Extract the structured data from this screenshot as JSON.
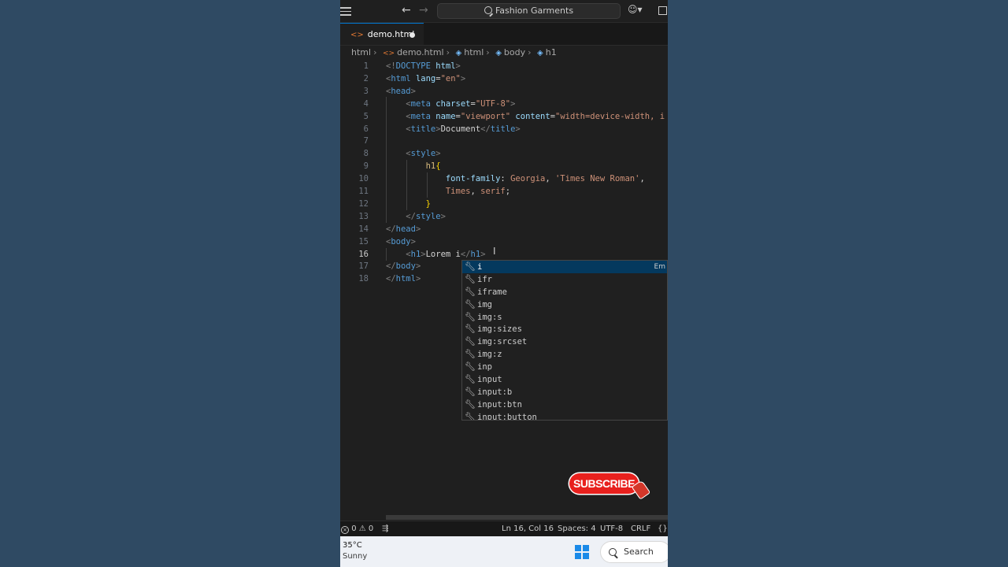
{
  "titlebar": {
    "search_text": "Fashion Garments",
    "icons": [
      "menu-icon",
      "arrow-left-icon",
      "arrow-right-icon",
      "copilot-icon",
      "layout-icon"
    ]
  },
  "tabs": [
    {
      "label": "demo.html",
      "modified": true
    }
  ],
  "breadcrumb": [
    "html",
    "demo.html",
    "html",
    "body",
    "h1"
  ],
  "editor": {
    "lines": [
      {
        "n": "1",
        "segments": [
          [
            "tg",
            "<!"
          ],
          [
            "tn",
            "DOCTYPE"
          ],
          [
            "tx",
            " "
          ],
          [
            "at",
            "html"
          ],
          [
            "tg",
            ">"
          ]
        ]
      },
      {
        "n": "2",
        "segments": [
          [
            "tg",
            "<"
          ],
          [
            "tn",
            "html"
          ],
          [
            "tx",
            " "
          ],
          [
            "at",
            "lang"
          ],
          [
            "tx",
            "="
          ],
          [
            "sv",
            "\"en\""
          ],
          [
            "tg",
            ">"
          ]
        ]
      },
      {
        "n": "3",
        "segments": [
          [
            "tg",
            "<"
          ],
          [
            "tn",
            "head"
          ],
          [
            "tg",
            ">"
          ]
        ]
      },
      {
        "n": "4",
        "segments": [
          [
            "tx",
            "    "
          ],
          [
            "tg",
            "<"
          ],
          [
            "tn",
            "meta"
          ],
          [
            "tx",
            " "
          ],
          [
            "at",
            "charset"
          ],
          [
            "tx",
            "="
          ],
          [
            "sv",
            "\"UTF-8\""
          ],
          [
            "tg",
            ">"
          ]
        ]
      },
      {
        "n": "5",
        "segments": [
          [
            "tx",
            "    "
          ],
          [
            "tg",
            "<"
          ],
          [
            "tn",
            "meta"
          ],
          [
            "tx",
            " "
          ],
          [
            "at",
            "name"
          ],
          [
            "tx",
            "="
          ],
          [
            "sv",
            "\"viewport\""
          ],
          [
            "tx",
            " "
          ],
          [
            "at",
            "content"
          ],
          [
            "tx",
            "="
          ],
          [
            "sv",
            "\"width=device-width, i"
          ]
        ]
      },
      {
        "n": "6",
        "segments": [
          [
            "tx",
            "    "
          ],
          [
            "tg",
            "<"
          ],
          [
            "tn",
            "title"
          ],
          [
            "tg",
            ">"
          ],
          [
            "tx",
            "Document"
          ],
          [
            "tg",
            "</"
          ],
          [
            "tn",
            "title"
          ],
          [
            "tg",
            ">"
          ]
        ]
      },
      {
        "n": "7",
        "segments": []
      },
      {
        "n": "8",
        "segments": [
          [
            "tx",
            "    "
          ],
          [
            "tg",
            "<"
          ],
          [
            "tn",
            "style"
          ],
          [
            "tg",
            ">"
          ]
        ]
      },
      {
        "n": "9",
        "segments": [
          [
            "tx",
            "        "
          ],
          [
            "sel",
            "h1"
          ],
          [
            "br",
            "{"
          ]
        ]
      },
      {
        "n": "10",
        "segments": [
          [
            "tx",
            "            "
          ],
          [
            "pr",
            "font-family"
          ],
          [
            "tx",
            ": "
          ],
          [
            "vl",
            "Georgia"
          ],
          [
            "tx",
            ", "
          ],
          [
            "vl",
            "'Times New Roman'"
          ],
          [
            "tx",
            ","
          ]
        ]
      },
      {
        "n": "11",
        "segments": [
          [
            "tx",
            "            "
          ],
          [
            "vl",
            "Times"
          ],
          [
            "tx",
            ", "
          ],
          [
            "vl",
            "serif"
          ],
          [
            "tx",
            ";"
          ]
        ]
      },
      {
        "n": "12",
        "segments": [
          [
            "tx",
            "        "
          ],
          [
            "br",
            "}"
          ]
        ]
      },
      {
        "n": "13",
        "segments": [
          [
            "tx",
            "    "
          ],
          [
            "tg",
            "</"
          ],
          [
            "tn",
            "style"
          ],
          [
            "tg",
            ">"
          ]
        ]
      },
      {
        "n": "14",
        "segments": [
          [
            "tg",
            "</"
          ],
          [
            "tn",
            "head"
          ],
          [
            "tg",
            ">"
          ]
        ]
      },
      {
        "n": "15",
        "segments": [
          [
            "tg",
            "<"
          ],
          [
            "tn",
            "body"
          ],
          [
            "tg",
            ">"
          ]
        ]
      },
      {
        "n": "16",
        "segments": [
          [
            "tx",
            "    "
          ],
          [
            "tg",
            "<"
          ],
          [
            "tn",
            "h1"
          ],
          [
            "tg",
            ">"
          ],
          [
            "tx",
            "Lorem i"
          ],
          [
            "tg",
            "</"
          ],
          [
            "tn",
            "h1"
          ],
          [
            "tg",
            ">"
          ]
        ],
        "active": true
      },
      {
        "n": "17",
        "segments": [
          [
            "tg",
            "</"
          ],
          [
            "tn",
            "body"
          ],
          [
            "tg",
            ">"
          ]
        ]
      },
      {
        "n": "18",
        "segments": [
          [
            "tg",
            "</"
          ],
          [
            "tn",
            "html"
          ],
          [
            "tg",
            ">"
          ]
        ]
      }
    ]
  },
  "suggestions": {
    "items": [
      "i",
      "ifr",
      "iframe",
      "img",
      "img:s",
      "img:sizes",
      "img:srcset",
      "img:z",
      "inp",
      "input",
      "input:b",
      "input:btn",
      "input:button"
    ],
    "selected_hint": "Em"
  },
  "subscribe_label": "SUBSCRIBE",
  "statusbar": {
    "errors": "0",
    "warnings": "0",
    "position": "Ln 16, Col 16",
    "spaces": "Spaces: 4",
    "encoding": "UTF-8",
    "eol": "CRLF"
  },
  "taskbar": {
    "temperature": "35°C",
    "condition": "Sunny",
    "search_label": "Search"
  },
  "colors": {
    "accent": "#0078d4",
    "editor_bg": "#1f1f1f",
    "suggest_selected": "#04395e",
    "subscribe_red": "#e8201d"
  }
}
